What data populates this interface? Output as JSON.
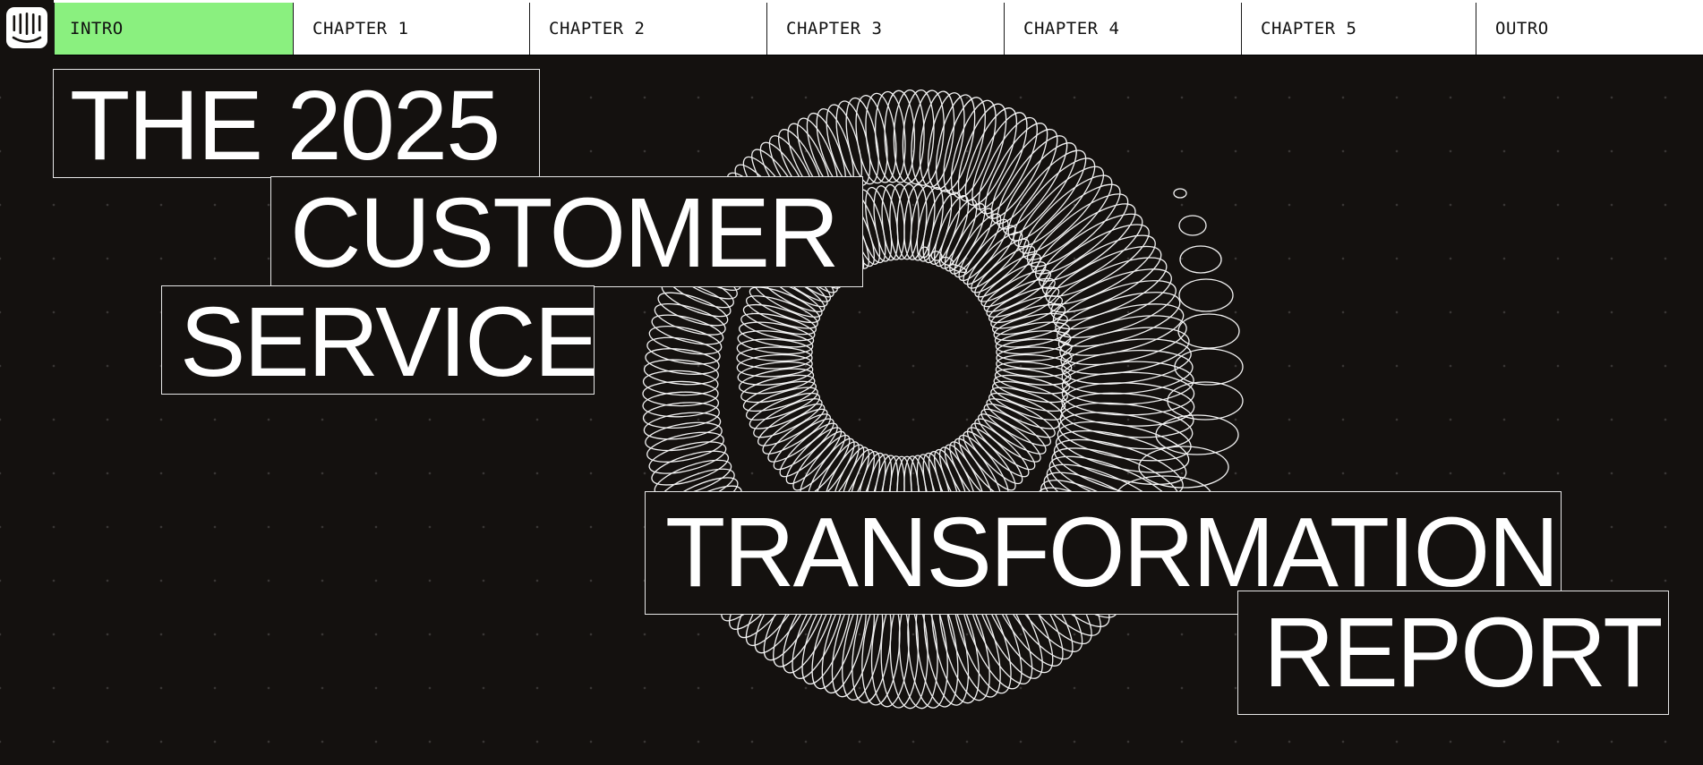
{
  "nav": {
    "logo_icon": "intercom-logo-icon",
    "tabs": [
      {
        "label": "INTRO",
        "active": true
      },
      {
        "label": "CHAPTER 1",
        "active": false
      },
      {
        "label": "CHAPTER 2",
        "active": false
      },
      {
        "label": "CHAPTER 3",
        "active": false
      },
      {
        "label": "CHAPTER 4",
        "active": false
      },
      {
        "label": "CHAPTER 5",
        "active": false
      },
      {
        "label": "OUTRO",
        "active": false
      }
    ],
    "active_color": "#8af07f"
  },
  "hero": {
    "title_lines": [
      "THE 2025",
      "CUSTOMER",
      "SERVICE",
      "TRANSFORMATION",
      "REPORT"
    ],
    "background_color": "#14110f",
    "text_color": "#ffffff",
    "art_icon": "spiral-rings-illustration"
  }
}
